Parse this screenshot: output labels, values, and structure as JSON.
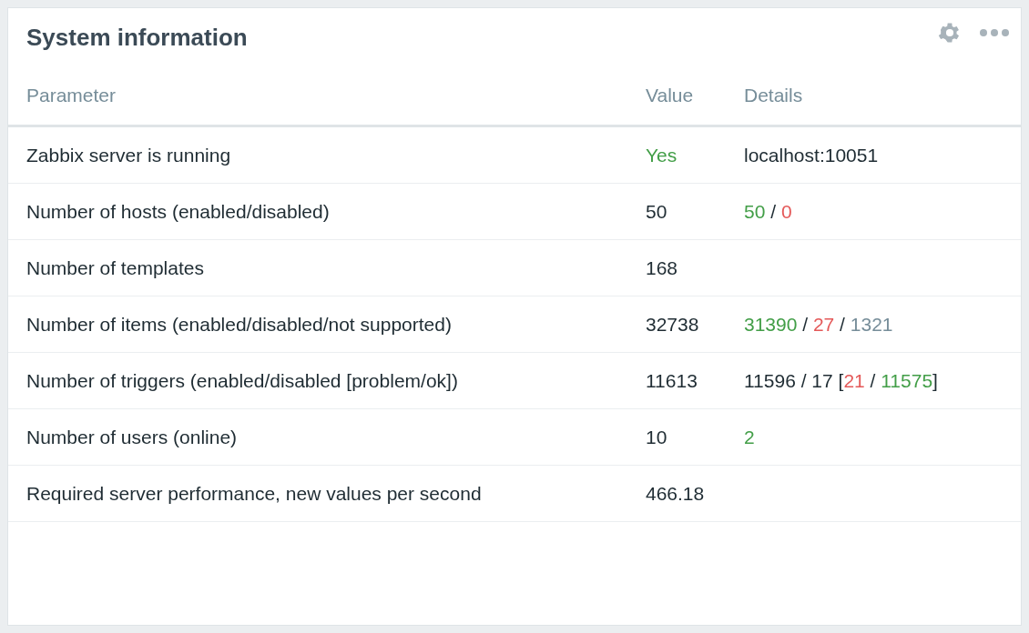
{
  "widget": {
    "title": "System information"
  },
  "table": {
    "columns": [
      "Parameter",
      "Value",
      "Details"
    ],
    "rows": [
      {
        "parameter": "Zabbix server is running",
        "value": "Yes",
        "color": "#429e47",
        "details": [
          {
            "text": "localhost:10051",
            "color": "#1f2c33"
          }
        ]
      },
      {
        "parameter": "Number of hosts (enabled/disabled)",
        "value": "50",
        "details": [
          {
            "text": "50",
            "color": "#429e47"
          },
          {
            "text": " / ",
            "color": "#1f2c33"
          },
          {
            "text": "0",
            "color": "#e45959"
          }
        ]
      },
      {
        "parameter": "Number of templates",
        "value": "168",
        "details": []
      },
      {
        "parameter": "Number of items (enabled/disabled/not supported)",
        "value": "32738",
        "details": [
          {
            "text": "31390",
            "color": "#429e47"
          },
          {
            "text": " / ",
            "color": "#1f2c33"
          },
          {
            "text": "27",
            "color": "#e45959"
          },
          {
            "text": " / ",
            "color": "#1f2c33"
          },
          {
            "text": "1321",
            "color": "#768d99"
          }
        ]
      },
      {
        "parameter": "Number of triggers (enabled/disabled [problem/ok])",
        "value": "11613",
        "details": [
          {
            "text": "11596 / 17 [",
            "color": "#1f2c33"
          },
          {
            "text": "21",
            "color": "#e45959"
          },
          {
            "text": " / ",
            "color": "#1f2c33"
          },
          {
            "text": "11575",
            "color": "#429e47"
          },
          {
            "text": "]",
            "color": "#1f2c33"
          }
        ]
      },
      {
        "parameter": "Number of users (online)",
        "value": "10",
        "details": [
          {
            "text": "2",
            "color": "#429e47"
          }
        ]
      },
      {
        "parameter": "Required server performance, new values per second",
        "value": "466.18",
        "details": []
      }
    ]
  }
}
